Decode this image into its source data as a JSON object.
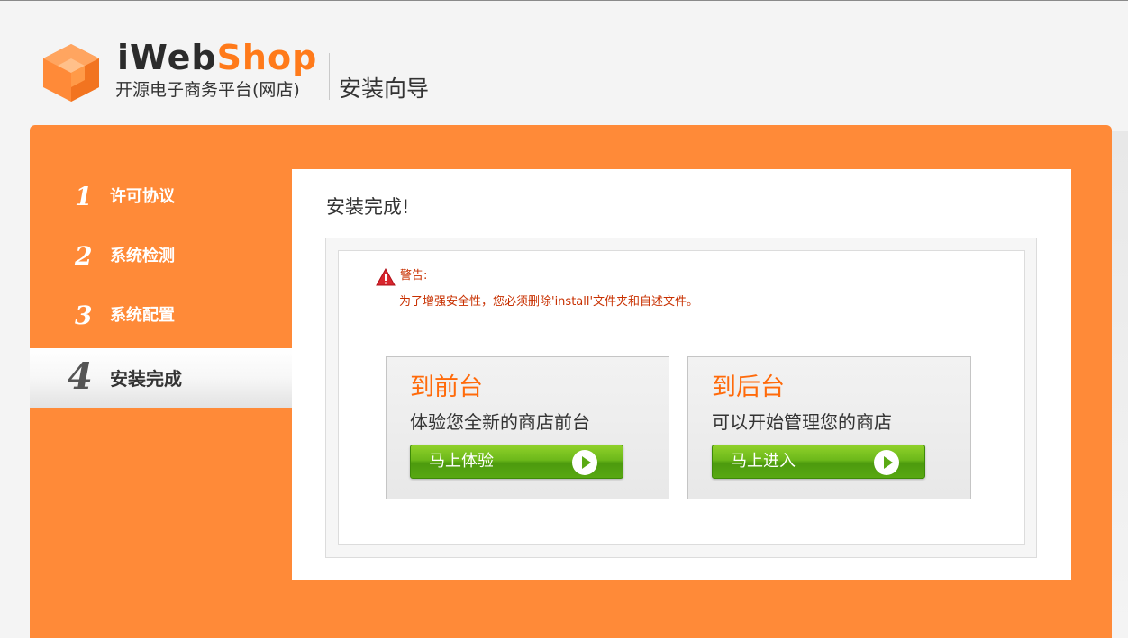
{
  "header": {
    "brand_part1": "iWeb",
    "brand_part2": "Shop",
    "brand_subtitle": "开源电子商务平台(网店)",
    "wizard_title": "安装向导"
  },
  "steps": [
    {
      "num": "1",
      "label": "许可协议",
      "active": false
    },
    {
      "num": "2",
      "label": "系统检测",
      "active": false
    },
    {
      "num": "3",
      "label": "系统配置",
      "active": false
    },
    {
      "num": "4",
      "label": "安装完成",
      "active": true
    }
  ],
  "content": {
    "title": "安装完成!",
    "warning_title": "警告:",
    "warning_message": "为了增强安全性，您必须删除'install'文件夹和自述文件。"
  },
  "cards": {
    "front": {
      "title": "到前台",
      "desc": "体验您全新的商店前台",
      "button": "马上体验"
    },
    "back": {
      "title": "到后台",
      "desc": "可以开始管理您的商店",
      "button": "马上进入"
    }
  },
  "colors": {
    "accent": "#ff8a38",
    "brand_orange": "#ff7a1a",
    "button_green": "#6cb81a",
    "warning_red": "#c83000"
  }
}
